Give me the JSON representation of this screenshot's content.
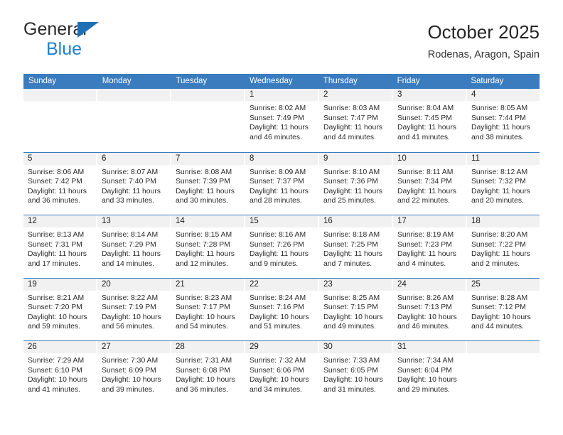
{
  "brand": {
    "line1": "General",
    "line2": "Blue",
    "triangle_color": "#1f6fb5",
    "blue_text_color": "#1f7fd0"
  },
  "header": {
    "title": "October 2025",
    "subtitle": "Rodenas, Aragon, Spain"
  },
  "theme": {
    "header_blue": "#3a7cbe",
    "daynum_gray": "#f1f1f1"
  },
  "weekdays": [
    "Sunday",
    "Monday",
    "Tuesday",
    "Wednesday",
    "Thursday",
    "Friday",
    "Saturday"
  ],
  "weeks": [
    [
      {
        "day": "",
        "empty": true,
        "sunrise": "",
        "sunset": "",
        "daylight1": "",
        "daylight2": ""
      },
      {
        "day": "",
        "empty": true,
        "sunrise": "",
        "sunset": "",
        "daylight1": "",
        "daylight2": ""
      },
      {
        "day": "",
        "empty": true,
        "sunrise": "",
        "sunset": "",
        "daylight1": "",
        "daylight2": ""
      },
      {
        "day": "1",
        "sunrise": "Sunrise: 8:02 AM",
        "sunset": "Sunset: 7:49 PM",
        "daylight1": "Daylight: 11 hours",
        "daylight2": "and 46 minutes."
      },
      {
        "day": "2",
        "sunrise": "Sunrise: 8:03 AM",
        "sunset": "Sunset: 7:47 PM",
        "daylight1": "Daylight: 11 hours",
        "daylight2": "and 44 minutes."
      },
      {
        "day": "3",
        "sunrise": "Sunrise: 8:04 AM",
        "sunset": "Sunset: 7:45 PM",
        "daylight1": "Daylight: 11 hours",
        "daylight2": "and 41 minutes."
      },
      {
        "day": "4",
        "sunrise": "Sunrise: 8:05 AM",
        "sunset": "Sunset: 7:44 PM",
        "daylight1": "Daylight: 11 hours",
        "daylight2": "and 38 minutes."
      }
    ],
    [
      {
        "day": "5",
        "sunrise": "Sunrise: 8:06 AM",
        "sunset": "Sunset: 7:42 PM",
        "daylight1": "Daylight: 11 hours",
        "daylight2": "and 36 minutes."
      },
      {
        "day": "6",
        "sunrise": "Sunrise: 8:07 AM",
        "sunset": "Sunset: 7:40 PM",
        "daylight1": "Daylight: 11 hours",
        "daylight2": "and 33 minutes."
      },
      {
        "day": "7",
        "sunrise": "Sunrise: 8:08 AM",
        "sunset": "Sunset: 7:39 PM",
        "daylight1": "Daylight: 11 hours",
        "daylight2": "and 30 minutes."
      },
      {
        "day": "8",
        "sunrise": "Sunrise: 8:09 AM",
        "sunset": "Sunset: 7:37 PM",
        "daylight1": "Daylight: 11 hours",
        "daylight2": "and 28 minutes."
      },
      {
        "day": "9",
        "sunrise": "Sunrise: 8:10 AM",
        "sunset": "Sunset: 7:36 PM",
        "daylight1": "Daylight: 11 hours",
        "daylight2": "and 25 minutes."
      },
      {
        "day": "10",
        "sunrise": "Sunrise: 8:11 AM",
        "sunset": "Sunset: 7:34 PM",
        "daylight1": "Daylight: 11 hours",
        "daylight2": "and 22 minutes."
      },
      {
        "day": "11",
        "sunrise": "Sunrise: 8:12 AM",
        "sunset": "Sunset: 7:32 PM",
        "daylight1": "Daylight: 11 hours",
        "daylight2": "and 20 minutes."
      }
    ],
    [
      {
        "day": "12",
        "sunrise": "Sunrise: 8:13 AM",
        "sunset": "Sunset: 7:31 PM",
        "daylight1": "Daylight: 11 hours",
        "daylight2": "and 17 minutes."
      },
      {
        "day": "13",
        "sunrise": "Sunrise: 8:14 AM",
        "sunset": "Sunset: 7:29 PM",
        "daylight1": "Daylight: 11 hours",
        "daylight2": "and 14 minutes."
      },
      {
        "day": "14",
        "sunrise": "Sunrise: 8:15 AM",
        "sunset": "Sunset: 7:28 PM",
        "daylight1": "Daylight: 11 hours",
        "daylight2": "and 12 minutes."
      },
      {
        "day": "15",
        "sunrise": "Sunrise: 8:16 AM",
        "sunset": "Sunset: 7:26 PM",
        "daylight1": "Daylight: 11 hours",
        "daylight2": "and 9 minutes."
      },
      {
        "day": "16",
        "sunrise": "Sunrise: 8:18 AM",
        "sunset": "Sunset: 7:25 PM",
        "daylight1": "Daylight: 11 hours",
        "daylight2": "and 7 minutes."
      },
      {
        "day": "17",
        "sunrise": "Sunrise: 8:19 AM",
        "sunset": "Sunset: 7:23 PM",
        "daylight1": "Daylight: 11 hours",
        "daylight2": "and 4 minutes."
      },
      {
        "day": "18",
        "sunrise": "Sunrise: 8:20 AM",
        "sunset": "Sunset: 7:22 PM",
        "daylight1": "Daylight: 11 hours",
        "daylight2": "and 2 minutes."
      }
    ],
    [
      {
        "day": "19",
        "sunrise": "Sunrise: 8:21 AM",
        "sunset": "Sunset: 7:20 PM",
        "daylight1": "Daylight: 10 hours",
        "daylight2": "and 59 minutes."
      },
      {
        "day": "20",
        "sunrise": "Sunrise: 8:22 AM",
        "sunset": "Sunset: 7:19 PM",
        "daylight1": "Daylight: 10 hours",
        "daylight2": "and 56 minutes."
      },
      {
        "day": "21",
        "sunrise": "Sunrise: 8:23 AM",
        "sunset": "Sunset: 7:17 PM",
        "daylight1": "Daylight: 10 hours",
        "daylight2": "and 54 minutes."
      },
      {
        "day": "22",
        "sunrise": "Sunrise: 8:24 AM",
        "sunset": "Sunset: 7:16 PM",
        "daylight1": "Daylight: 10 hours",
        "daylight2": "and 51 minutes."
      },
      {
        "day": "23",
        "sunrise": "Sunrise: 8:25 AM",
        "sunset": "Sunset: 7:15 PM",
        "daylight1": "Daylight: 10 hours",
        "daylight2": "and 49 minutes."
      },
      {
        "day": "24",
        "sunrise": "Sunrise: 8:26 AM",
        "sunset": "Sunset: 7:13 PM",
        "daylight1": "Daylight: 10 hours",
        "daylight2": "and 46 minutes."
      },
      {
        "day": "25",
        "sunrise": "Sunrise: 8:28 AM",
        "sunset": "Sunset: 7:12 PM",
        "daylight1": "Daylight: 10 hours",
        "daylight2": "and 44 minutes."
      }
    ],
    [
      {
        "day": "26",
        "sunrise": "Sunrise: 7:29 AM",
        "sunset": "Sunset: 6:10 PM",
        "daylight1": "Daylight: 10 hours",
        "daylight2": "and 41 minutes."
      },
      {
        "day": "27",
        "sunrise": "Sunrise: 7:30 AM",
        "sunset": "Sunset: 6:09 PM",
        "daylight1": "Daylight: 10 hours",
        "daylight2": "and 39 minutes."
      },
      {
        "day": "28",
        "sunrise": "Sunrise: 7:31 AM",
        "sunset": "Sunset: 6:08 PM",
        "daylight1": "Daylight: 10 hours",
        "daylight2": "and 36 minutes."
      },
      {
        "day": "29",
        "sunrise": "Sunrise: 7:32 AM",
        "sunset": "Sunset: 6:06 PM",
        "daylight1": "Daylight: 10 hours",
        "daylight2": "and 34 minutes."
      },
      {
        "day": "30",
        "sunrise": "Sunrise: 7:33 AM",
        "sunset": "Sunset: 6:05 PM",
        "daylight1": "Daylight: 10 hours",
        "daylight2": "and 31 minutes."
      },
      {
        "day": "31",
        "sunrise": "Sunrise: 7:34 AM",
        "sunset": "Sunset: 6:04 PM",
        "daylight1": "Daylight: 10 hours",
        "daylight2": "and 29 minutes."
      },
      {
        "day": "",
        "empty": true,
        "sunrise": "",
        "sunset": "",
        "daylight1": "",
        "daylight2": ""
      }
    ]
  ]
}
